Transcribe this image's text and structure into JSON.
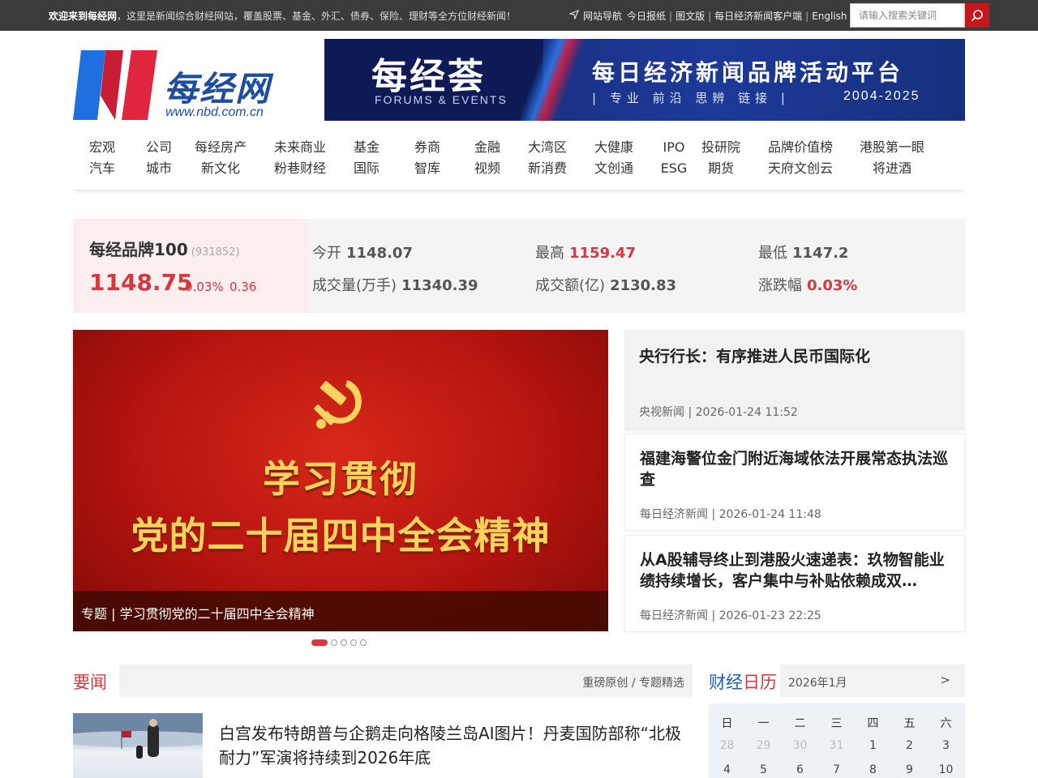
{
  "topbar": {
    "welcome_bold": "欢迎来到每经网",
    "welcome_rest": "，这里是新闻综合财经网站，覆盖股票、基金、外汇、债券、保险、理财等全方位财经新闻！",
    "links": [
      "网站导航",
      "今日报纸",
      "图文版",
      "每日经济新闻客户端",
      "English"
    ],
    "search_placeholder": "请输入搜索关键词"
  },
  "logo": {
    "name": "每经网",
    "url": "www.nbd.com.cn"
  },
  "banner": {
    "title": "每经荟",
    "subtitle": "FORUMS & EVENTS",
    "headline": "每日经济新闻品牌活动平台",
    "tagline": "| 专业 前沿 思辨 链接 |",
    "years": "2004-2025"
  },
  "nav": [
    {
      "top": "宏观",
      "bottom": "汽车"
    },
    {
      "top": "公司",
      "bottom": "城市"
    },
    {
      "top": "每经房产",
      "bottom": "新文化"
    },
    {
      "top": "未来商业",
      "bottom": "粉巷财经"
    },
    {
      "top": "基金",
      "bottom": "国际"
    },
    {
      "top": "券商",
      "bottom": "智库"
    },
    {
      "top": "金融",
      "bottom": "视频"
    },
    {
      "top": "大湾区",
      "bottom": "新消费"
    },
    {
      "top": "大健康",
      "bottom": "文创通"
    },
    {
      "top": "IPO",
      "bottom": "ESG"
    },
    {
      "top": "投研院",
      "bottom": "期货"
    },
    {
      "top": "品牌价值榜",
      "bottom": "天府文创云"
    },
    {
      "top": "港股第一眼",
      "bottom": "将进酒"
    }
  ],
  "stock": {
    "name": "每经品牌100",
    "code": "(931852)",
    "price": "1148.75",
    "pct": "0.03%",
    "chg": "0.36",
    "open_label": "今开",
    "open": "1148.07",
    "high_label": "最高",
    "high": "1159.47",
    "low_label": "最低",
    "low": "1147.2",
    "volume_label": "成交量(万手)",
    "volume": "11340.39",
    "amount_label": "成交额(亿)",
    "amount": "2130.83",
    "range_label": "涨跌幅",
    "range": "0.03%"
  },
  "carousel": {
    "line1": "学习贯彻",
    "line2": "党的二十届四中全会精神",
    "caption": "专题 | 学习贯彻党的二十届四中全会精神",
    "slide_count": 5,
    "active_index": 0
  },
  "news": [
    {
      "title": "央行行长：有序推进人民币国际化",
      "source": "央视新闻",
      "time": "2026-01-24 11:52"
    },
    {
      "title": "福建海警位金门附近海域依法开展常态执法巡查",
      "source": "每日经济新闻",
      "time": "2026-01-24 11:48"
    },
    {
      "title": "从A股辅导终止到港股火速递表：玖物智能业绩持续增长，客户集中与补贴依赖成双…",
      "source": "每日经济新闻",
      "time": "2026-01-23 22:25"
    }
  ],
  "yaowen": {
    "label": "要闻",
    "links": "重磅原创 / 专题精选",
    "headline": "白宫发布特朗普与企鹅走向格陵兰岛AI图片！丹麦国防部称“北极耐力”军演将持续到2026年底"
  },
  "calendar": {
    "title_a": "财经",
    "title_b": "日历",
    "month": "2026年1月",
    "next": ">",
    "weekdays": [
      "日",
      "一",
      "二",
      "三",
      "四",
      "五",
      "六"
    ],
    "row1": [
      "28",
      "29",
      "30",
      "31",
      "1",
      "2",
      "3"
    ],
    "row2": [
      "4",
      "5",
      "6",
      "7",
      "8",
      "9",
      "10"
    ]
  },
  "colors": {
    "accent_red": "#d9373e",
    "brand_blue": "#1c4d9e",
    "topbar": "#3b3b3b"
  }
}
